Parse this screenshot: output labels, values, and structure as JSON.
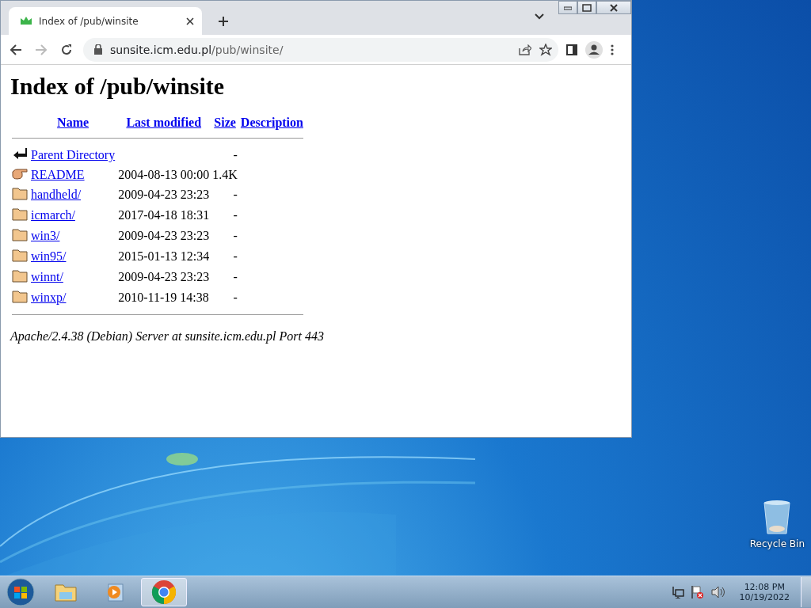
{
  "browser": {
    "tab": {
      "title": "Index of /pub/winsite",
      "selected": true
    },
    "address": {
      "host": "sunsite.icm.edu.pl",
      "path": "/pub/winsite/"
    }
  },
  "page": {
    "heading": "Index of /pub/winsite",
    "columns": [
      "Name",
      "Last modified",
      "Size",
      "Description"
    ],
    "rows": [
      {
        "kind": "back",
        "name": "Parent Directory",
        "modified": "",
        "size": "-"
      },
      {
        "kind": "text",
        "name": "README",
        "modified": "2004-08-13 00:00",
        "size": "1.4K"
      },
      {
        "kind": "folder",
        "name": "handheld/",
        "modified": "2009-04-23 23:23",
        "size": "-"
      },
      {
        "kind": "folder",
        "name": "icmarch/",
        "modified": "2017-04-18 18:31",
        "size": "-"
      },
      {
        "kind": "folder",
        "name": "win3/",
        "modified": "2009-04-23 23:23",
        "size": "-"
      },
      {
        "kind": "folder",
        "name": "win95/",
        "modified": "2015-01-13 12:34",
        "size": "-"
      },
      {
        "kind": "folder",
        "name": "winnt/",
        "modified": "2009-04-23 23:23",
        "size": "-"
      },
      {
        "kind": "folder",
        "name": "winxp/",
        "modified": "2010-11-19 14:38",
        "size": "-"
      }
    ],
    "footer": "Apache/2.4.38 (Debian) Server at sunsite.icm.edu.pl Port 443"
  },
  "desktop": {
    "icons": [
      {
        "label": "Recycle Bin"
      }
    ]
  },
  "taskbar": {
    "apps": [
      {
        "kind": "explorer",
        "selected": false
      },
      {
        "kind": "media",
        "selected": false
      },
      {
        "kind": "chrome",
        "selected": true
      }
    ],
    "time": "12:08 PM",
    "date": "10/19/2022"
  }
}
